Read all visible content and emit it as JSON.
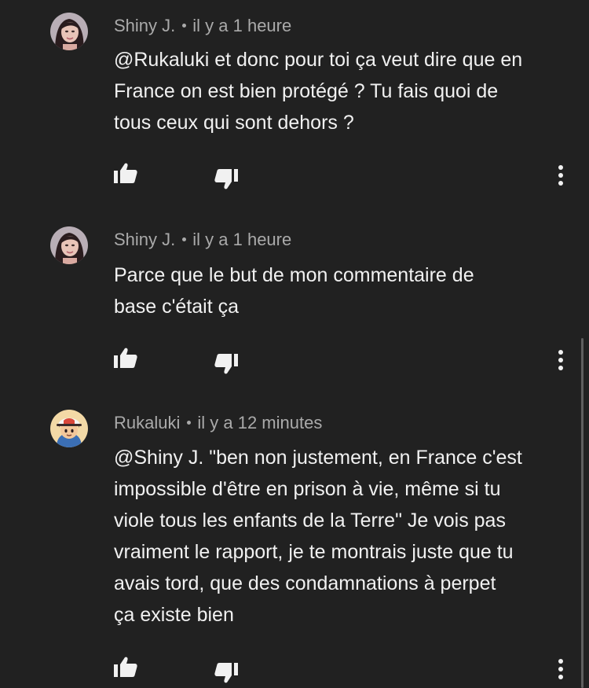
{
  "comments": [
    {
      "author": "Shiny J.",
      "time": "il y a 1 heure",
      "text_lines": [
        "@Rukaluki et donc pour toi ça veut dire que en",
        "France on est bien protégé ? Tu fais quoi de",
        "tous ceux qui sont dehors ?"
      ],
      "avatar_icon": "user-avatar-woman"
    },
    {
      "author": "Shiny J.",
      "time": "il y a 1 heure",
      "text_lines": [
        "Parce que le but de mon commentaire de",
        "base c'était ça"
      ],
      "avatar_icon": "user-avatar-woman"
    },
    {
      "author": "Rukaluki",
      "time": "il y a 12 minutes",
      "text_lines": [
        "@Shiny J. \"ben non justement, en France c'est",
        "impossible d'être en prison à vie, même si tu",
        "viole tous les enfants de la Terre\" Je vois pas",
        "vraiment le rapport, je te montrais juste que tu",
        "avais tord, que des condamnations à perpet",
        "ça existe bien"
      ],
      "avatar_icon": "user-avatar-cartoon-cap"
    }
  ],
  "icons": {
    "like": "thumbs-up-icon",
    "dislike": "thumbs-down-icon",
    "more": "more-vert-icon"
  },
  "colors": {
    "background": "#212121",
    "text": "#f1f1f1",
    "meta": "#aaaaaa",
    "icon": "#f1f1f1"
  }
}
